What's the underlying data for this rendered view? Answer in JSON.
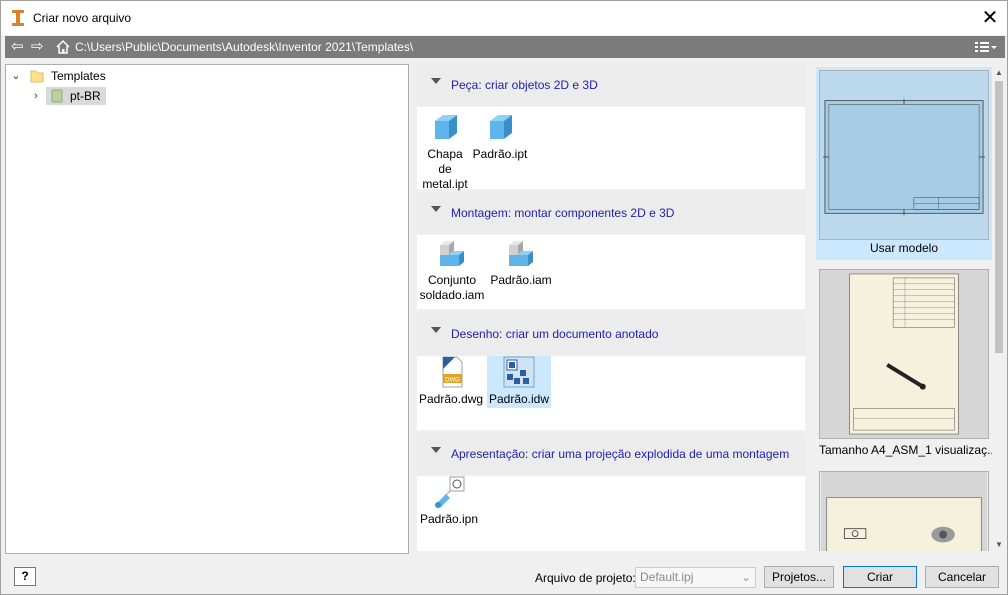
{
  "window": {
    "title": "Criar novo arquivo",
    "close_glyph": "✕"
  },
  "pathbar": {
    "path": "C:\\Users\\Public\\Documents\\Autodesk\\Inventor 2021\\Templates\\",
    "back_glyph": "⇦",
    "forward_glyph": "⇨"
  },
  "tree": {
    "root": {
      "label": "Templates",
      "expander": "⌄"
    },
    "child": {
      "label": "pt-BR",
      "expander": "›"
    }
  },
  "categories": [
    {
      "label": "Peça: criar objetos 2D e 3D",
      "items": [
        {
          "label": "Chapa de metal.ipt",
          "icon": "part-cube-icon"
        },
        {
          "label": "Padrão.ipt",
          "icon": "part-cube-icon"
        }
      ]
    },
    {
      "label": "Montagem: montar componentes 2D e 3D",
      "items": [
        {
          "label": "Conjunto soldado.iam",
          "icon": "assembly-icon"
        },
        {
          "label": "Padrão.iam",
          "icon": "assembly-icon"
        }
      ]
    },
    {
      "label": "Desenho: criar um documento anotado",
      "items": [
        {
          "label": "Padrão.dwg",
          "icon": "dwg-icon",
          "badge": "DWG"
        },
        {
          "label": "Padrão.idw",
          "icon": "idw-icon"
        }
      ]
    },
    {
      "label": "Apresentação: criar uma projeção explodida de uma montagem",
      "items": [
        {
          "label": "Padrão.ipn",
          "icon": "presentation-icon"
        }
      ]
    }
  ],
  "previews": [
    {
      "caption": "Usar modelo"
    },
    {
      "caption": "Tamanho A4_ASM_1 visualizaç..."
    },
    {
      "caption": ""
    }
  ],
  "footer": {
    "help_glyph": "?",
    "project_label": "Arquivo de projeto:",
    "project_value": "Default.ipj",
    "projects_button": "Projetos...",
    "create_button": "Criar",
    "cancel_button": "Cancelar"
  },
  "colors": {
    "accent": "#0078d7",
    "category_link": "#1e1eb4",
    "selection": "#cce8ff",
    "pathbar": "#7b7b7b"
  }
}
